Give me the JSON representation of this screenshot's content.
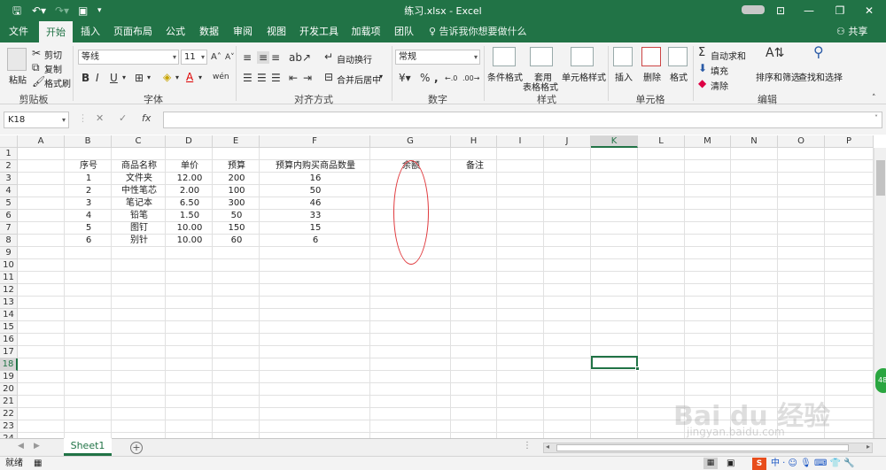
{
  "window": {
    "title": "练习.xlsx  -  Excel",
    "minimize": "—",
    "restore": "❐",
    "close": "✕",
    "ribbon_display": "⊡"
  },
  "tabs": [
    {
      "label": "文件"
    },
    {
      "label": "开始"
    },
    {
      "label": "插入"
    },
    {
      "label": "页面布局"
    },
    {
      "label": "公式"
    },
    {
      "label": "数据"
    },
    {
      "label": "审阅"
    },
    {
      "label": "视图"
    },
    {
      "label": "开发工具"
    },
    {
      "label": "加载项"
    },
    {
      "label": "团队"
    }
  ],
  "tellme": "♀ 告诉我你想要做什么",
  "share": "共享",
  "ribbon": {
    "clipboard": {
      "label": "剪贴板",
      "paste": "粘贴",
      "cut": "剪切",
      "copy": "复制",
      "format_painter": "格式刷"
    },
    "font": {
      "label": "字体",
      "font_name": "等线",
      "font_size": "11",
      "bold": "B",
      "italic": "I",
      "underline": "U"
    },
    "alignment": {
      "label": "对齐方式",
      "wrap_text": "自动换行",
      "merge_center": "合并后居中"
    },
    "number": {
      "label": "数字",
      "format": "常规",
      "percent": "%",
      "comma": ","
    },
    "styles": {
      "label": "样式",
      "conditional": "条件格式",
      "table_format_1": "套用",
      "table_format_2": "表格格式",
      "cell_styles": "单元格样式"
    },
    "cells": {
      "label": "单元格",
      "insert": "插入",
      "delete": "删除",
      "format": "格式"
    },
    "editing": {
      "label": "编辑",
      "autosum": "自动求和",
      "fill": "填充",
      "clear": "清除",
      "sort_filter": "排序和筛选",
      "find_select": "查找和选择"
    }
  },
  "formula_bar": {
    "name_box": "K18",
    "fx": "fx",
    "value": ""
  },
  "columns": [
    "A",
    "B",
    "C",
    "D",
    "E",
    "F",
    "G",
    "H",
    "I",
    "J",
    "K",
    "L",
    "M",
    "N",
    "O",
    "P"
  ],
  "rows": [
    "1",
    "2",
    "3",
    "4",
    "5",
    "6",
    "7",
    "8",
    "9",
    "10",
    "11",
    "12",
    "13",
    "14",
    "15",
    "16",
    "17",
    "18",
    "19",
    "20",
    "21",
    "22",
    "23",
    "24"
  ],
  "sheet": {
    "headers": {
      "seq": "序号",
      "name": "商品名称",
      "price": "单价",
      "budget": "预算",
      "qty": "预算内购买商品数量",
      "balance": "余额",
      "note": "备注"
    },
    "records": [
      {
        "seq": "1",
        "name": "文件夹",
        "price": "12.00",
        "budget": "200",
        "qty": "16"
      },
      {
        "seq": "2",
        "name": "中性笔芯",
        "price": "2.00",
        "budget": "100",
        "qty": "50"
      },
      {
        "seq": "3",
        "name": "笔记本",
        "price": "6.50",
        "budget": "300",
        "qty": "46"
      },
      {
        "seq": "4",
        "name": "铅笔",
        "price": "1.50",
        "budget": "50",
        "qty": "33"
      },
      {
        "seq": "5",
        "name": "图钉",
        "price": "10.00",
        "budget": "150",
        "qty": "15"
      },
      {
        "seq": "6",
        "name": "别针",
        "price": "10.00",
        "budget": "60",
        "qty": "6"
      }
    ]
  },
  "sheet_tabs": {
    "active": "Sheet1",
    "add": "+"
  },
  "status": {
    "ready": "就绪",
    "zoom_badge": "48"
  },
  "watermark": {
    "brand": "Bai du 经验",
    "url": "jingyan.baidu.com"
  }
}
